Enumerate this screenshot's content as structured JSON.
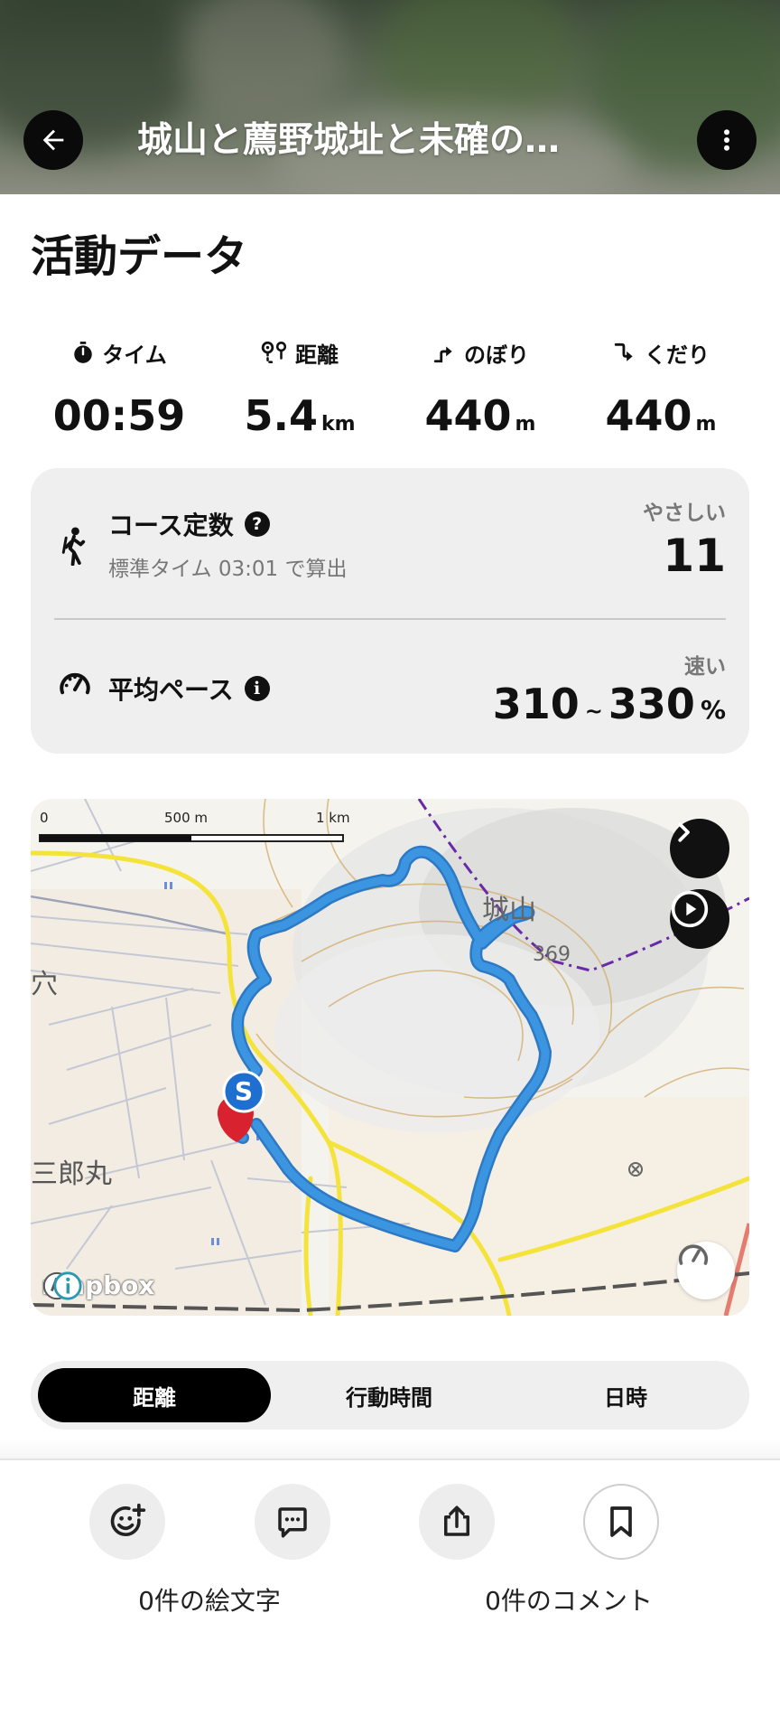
{
  "header": {
    "title": "城山と薦野城址と未確の…",
    "back_icon": "arrow-left-icon",
    "more_icon": "more-vertical-icon"
  },
  "section_title": "活動データ",
  "stats": [
    {
      "icon": "stopwatch-icon",
      "label": "タイム",
      "value": "00:59",
      "unit": ""
    },
    {
      "icon": "route-pin-icon",
      "label": "距離",
      "value": "5.4",
      "unit": "km"
    },
    {
      "icon": "ascent-icon",
      "label": "のぼり",
      "value": "440",
      "unit": "m"
    },
    {
      "icon": "descent-icon",
      "label": "くだり",
      "value": "440",
      "unit": "m"
    }
  ],
  "course": {
    "label": "コース定数",
    "help_icon": "question-icon",
    "sub": "標準タイム 03:01 で算出",
    "difficulty": "やさしい",
    "value": "11"
  },
  "pace": {
    "label": "平均ペース",
    "info_icon": "info-icon",
    "speed_label": "速い",
    "min": "310",
    "sep": "~",
    "max": "330",
    "unit": "%"
  },
  "map": {
    "scale_0": "0",
    "scale_500": "500 m",
    "scale_1k": "1 km",
    "place_shiroyama": "城山",
    "elevation": "369",
    "place_ana": "穴",
    "place_saburomaru": "三郎丸",
    "start_marker": "S",
    "attribution": "mapbox",
    "next_icon": "chevron-right-icon",
    "play_icon": "play-circle-icon",
    "speedometer_icon": "speedometer-icon"
  },
  "tabs": [
    {
      "label": "距離",
      "active": true
    },
    {
      "label": "行動時間",
      "active": false
    },
    {
      "label": "日時",
      "active": false
    }
  ],
  "actions": {
    "emoji_label": "0件の絵文字",
    "comment_label": "0件のコメント"
  },
  "colors": {
    "track": "#3b95e0",
    "start_marker": "#1e6fd0",
    "accent_dark": "#111111"
  }
}
